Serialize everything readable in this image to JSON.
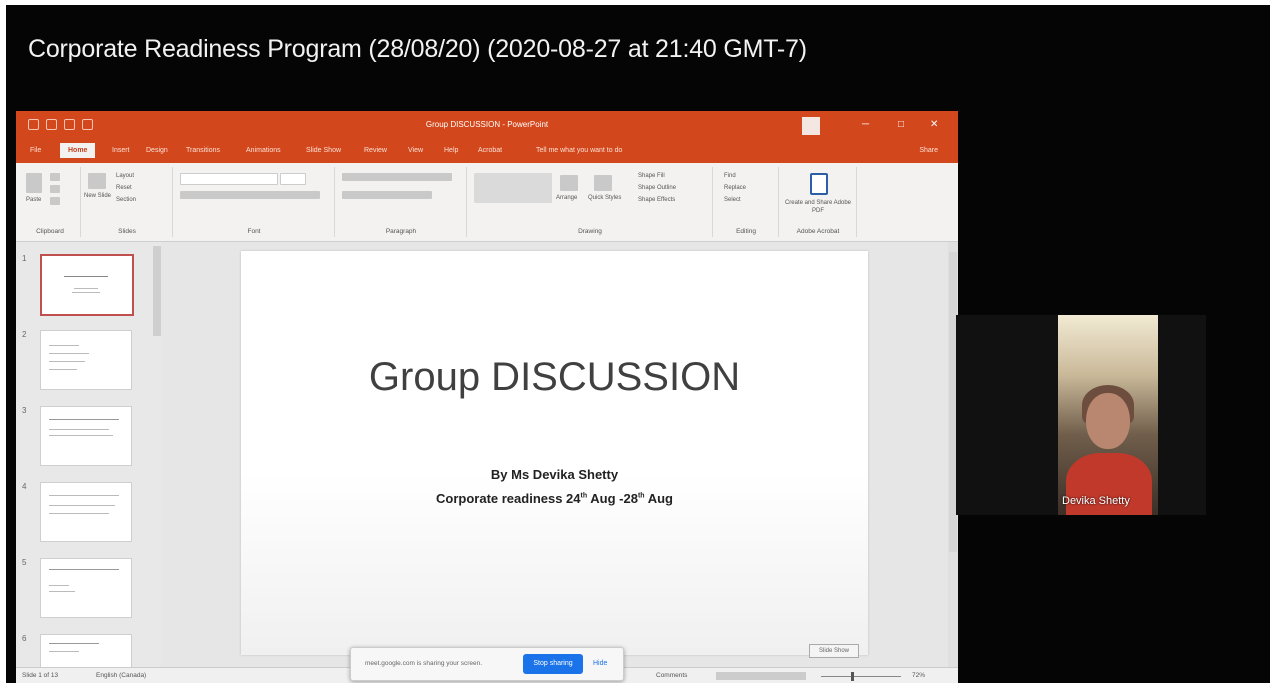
{
  "meeting": {
    "title": "Corporate Readiness Program (28/08/20) (2020-08-27 at 21:40 GMT-7)"
  },
  "powerpoint": {
    "document_title": "Group DISCUSSION - PowerPoint",
    "window_buttons": [
      "─",
      "□",
      "✕"
    ],
    "tabs": [
      "File",
      "Home",
      "Insert",
      "Design",
      "Transitions",
      "Animations",
      "Slide Show",
      "Review",
      "View",
      "Help",
      "Acrobat",
      "Tell me what you want to do"
    ],
    "active_tab": "Home",
    "share_label": "Share",
    "ribbon_groups": [
      "Clipboard",
      "Slides",
      "Font",
      "Paragraph",
      "Drawing",
      "Editing",
      "Adobe Acrobat"
    ],
    "ribbon_buttons": {
      "paste": "Paste",
      "new_slide": "New Slide",
      "layout": "Layout",
      "reset": "Reset",
      "section": "Section",
      "arrange": "Arrange",
      "quick_styles": "Quick Styles",
      "shape_fill": "Shape Fill",
      "shape_outline": "Shape Outline",
      "shape_effects": "Shape Effects",
      "find": "Find",
      "replace": "Replace",
      "select": "Select",
      "create_pdf": "Create and Share Adobe PDF"
    },
    "slide_numbers": [
      "1",
      "2",
      "3",
      "4",
      "5",
      "6"
    ],
    "slide": {
      "title": "Group DISCUSSION",
      "byline": "By Ms Devika Shetty",
      "subtitle_pre": "Corporate readiness 24",
      "sup1": "th",
      "subtitle_mid": " Aug -28",
      "sup2": "th",
      "subtitle_post": " Aug"
    },
    "hide_button": "Slide Show",
    "status": {
      "slide_counter": "Slide 1 of 13",
      "language": "English (Canada)",
      "comments": "Comments",
      "zoom": "72%"
    }
  },
  "sharing_bar": {
    "message": "meet.google.com is sharing your screen.",
    "stop_label": "Stop sharing",
    "hide_label": "Hide"
  },
  "participant": {
    "name": "Devika Shetty"
  }
}
